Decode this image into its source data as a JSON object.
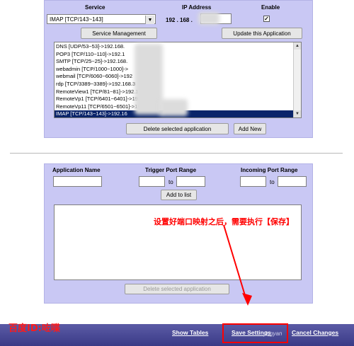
{
  "top_panel": {
    "service_header": "Service",
    "ip_header": "IP Address",
    "enable_header": "Enable",
    "service_select_value": "IMAP [TCP/143~143]",
    "ip_prefix": "192 . 168 .",
    "enable_checked": "✓",
    "service_management_label": "Service Management",
    "update_application_label": "Update this Application",
    "applications": [
      "DNS [UDP/53~53]->192.168.",
      "POP3 [TCP/110~110]->192.1",
      "SMTP [TCP/25~25]->192.168.",
      "webadmin [TCP/1000~1000]->",
      "webmail [TCP/6060~6060]->192",
      "rdp [TCP/3389~3389]->192.168.3",
      "RemoteView1 [TCP/81~81]->192.1",
      "RemoteVp1 [TCP/6401~6401]->192.",
      "RemoteVp11 [TCP/6501~6501]->192",
      "IMAP [TCP/143~143]->192.16"
    ],
    "delete_selected_label": "Delete selected application",
    "add_new_label": "Add New"
  },
  "bottom_panel": {
    "application_name_header": "Application Name",
    "trigger_range_header": "Trigger Port Range",
    "incoming_range_header": "Incoming Port Range",
    "to_label_1": "to",
    "to_label_2": "to",
    "add_to_list_label": "Add to list",
    "delete_selected_label": "Delete selected application"
  },
  "annotation": {
    "note": "设置好端口映射之后，需要执行【保存】"
  },
  "watermark": {
    "left_text": "百度ID:咗喋",
    "partial_text": "jingyan"
  },
  "bottom_bar": {
    "show_tables": "Show Tables",
    "save_settings": "Save Settings",
    "cancel_changes": "Cancel Changes"
  },
  "colors": {
    "panel": "#c9c8f4",
    "bar": "#3a3a86",
    "selection": "#0a246a",
    "annotation_red": "#ff0000"
  }
}
